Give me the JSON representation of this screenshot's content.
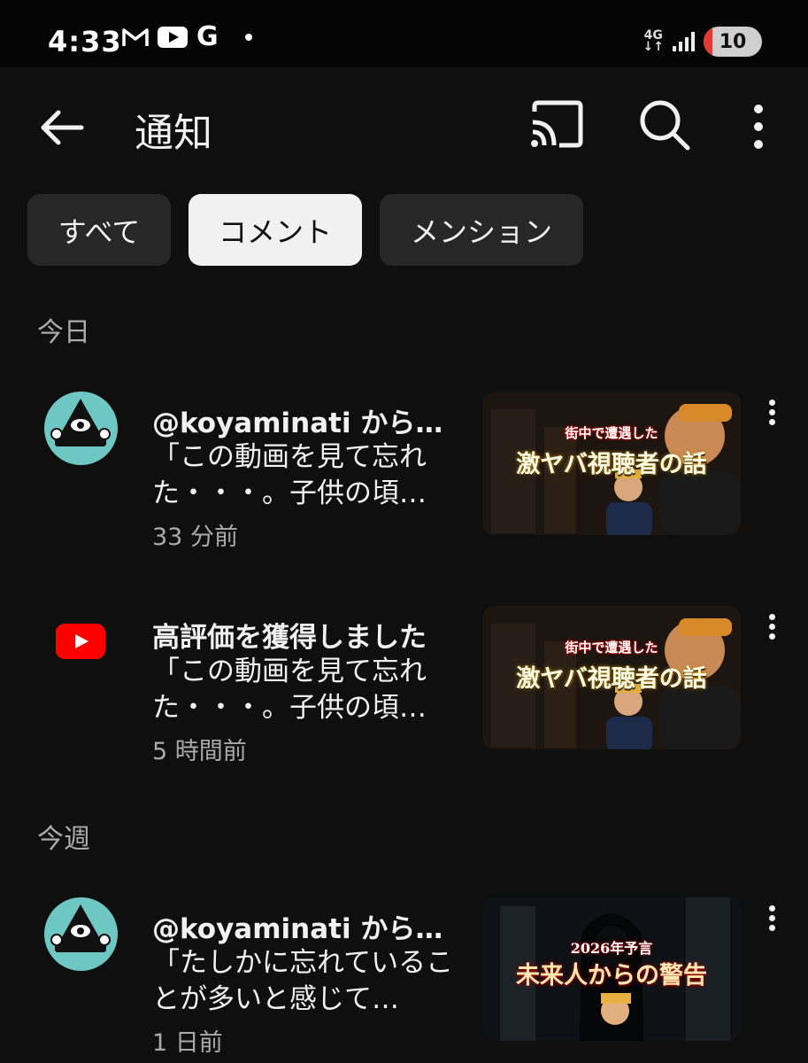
{
  "status_bar": {
    "time": "4:33",
    "google_letter": "G",
    "network": "4G",
    "battery": "10"
  },
  "app_bar": {
    "title": "通知"
  },
  "chips": [
    {
      "label": "すべて",
      "selected": false
    },
    {
      "label": "コメント",
      "selected": true
    },
    {
      "label": "メンション",
      "selected": false
    }
  ],
  "sections": [
    {
      "header": "今日",
      "notifications": [
        {
          "title": "@koyaminati から…",
          "body": "「この動画を見て忘れた・・・。子供の頃…",
          "time": "33 分前",
          "thumbnail": {
            "caption_small": "街中で遭遇した",
            "caption_large": "激ヤバ視聴者の話"
          }
        },
        {
          "title": "高評価を獲得しました",
          "body": "「この動画を見て忘れた・・・。子供の頃…",
          "time": "5 時間前",
          "thumbnail": {
            "caption_small": "街中で遭遇した",
            "caption_large": "激ヤバ視聴者の話"
          }
        }
      ]
    },
    {
      "header": "今週",
      "notifications": [
        {
          "title": "@koyaminati から…",
          "body": "「たしかに忘れていることが多いと感じて…",
          "time": "1 日前",
          "thumbnail": {
            "caption_small": "2026年予言",
            "caption_large": "未来人からの警告"
          }
        }
      ]
    }
  ],
  "colors": {
    "background": "#0f0f0f",
    "chip": "#272727",
    "chip_selected": "#f1f1f1",
    "secondary_text": "#aaaaaa",
    "youtube_red": "#ff0000",
    "avatar_teal": "#6ec7c2"
  }
}
